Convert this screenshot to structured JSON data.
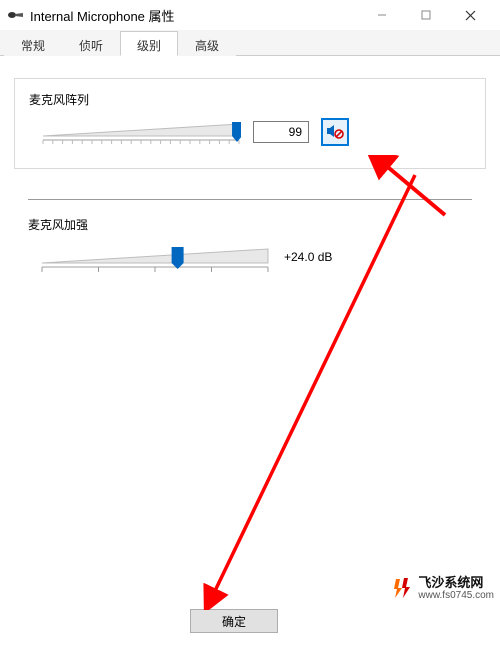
{
  "window": {
    "title": "Internal Microphone 属性"
  },
  "tabs": {
    "items": [
      {
        "label": "常规"
      },
      {
        "label": "侦听"
      },
      {
        "label": "级别"
      },
      {
        "label": "高级"
      }
    ],
    "active_index": 2
  },
  "mic_array": {
    "title": "麦克风阵列",
    "value": "99",
    "slider_percent": 99,
    "muted": true,
    "mute_icon": "speaker-muted-icon"
  },
  "mic_boost": {
    "title": "麦克风加强",
    "value": "+24.0 dB",
    "slider_percent": 60
  },
  "buttons": {
    "ok": "确定"
  },
  "watermark": {
    "title": "飞沙系统网",
    "url": "www.fs0745.com"
  }
}
